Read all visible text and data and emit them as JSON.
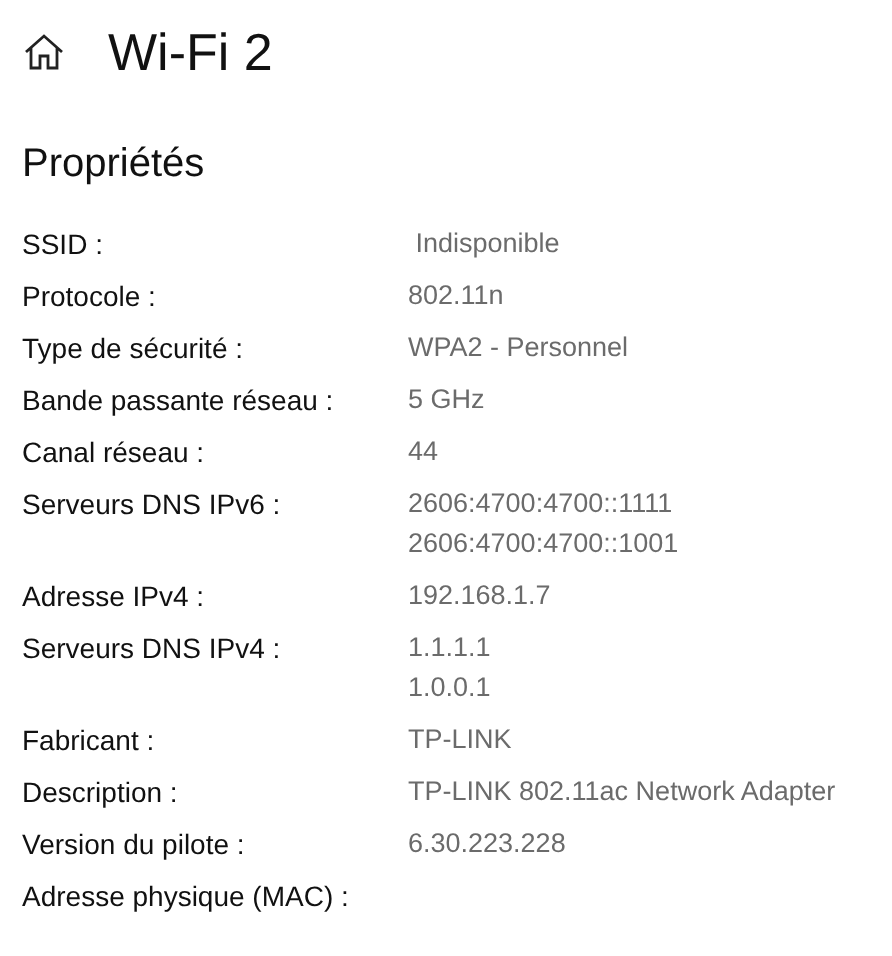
{
  "header": {
    "title": "Wi-Fi 2"
  },
  "section": {
    "title": "Propriétés"
  },
  "properties": [
    {
      "label": "SSID :",
      "values": [
        " Indisponible"
      ]
    },
    {
      "label": "Protocole :",
      "values": [
        "802.11n"
      ]
    },
    {
      "label": "Type de sécurité :",
      "values": [
        "WPA2 - Personnel"
      ]
    },
    {
      "label": "Bande passante réseau :",
      "values": [
        "5 GHz"
      ]
    },
    {
      "label": "Canal réseau :",
      "values": [
        "44"
      ]
    },
    {
      "label": "Serveurs DNS IPv6 :",
      "values": [
        "2606:4700:4700::1111",
        "2606:4700:4700::1001"
      ]
    },
    {
      "label": "Adresse IPv4 :",
      "values": [
        "192.168.1.7"
      ]
    },
    {
      "label": "Serveurs DNS IPv4 :",
      "values": [
        "1.1.1.1",
        "1.0.0.1"
      ]
    },
    {
      "label": "Fabricant :",
      "values": [
        "TP-LINK"
      ]
    },
    {
      "label": "Description :",
      "values": [
        "TP-LINK 802.11ac Network Adapter"
      ]
    },
    {
      "label": "Version du pilote :",
      "values": [
        "6.30.223.228"
      ]
    },
    {
      "label": "Adresse physique (MAC) :"
    }
  ]
}
